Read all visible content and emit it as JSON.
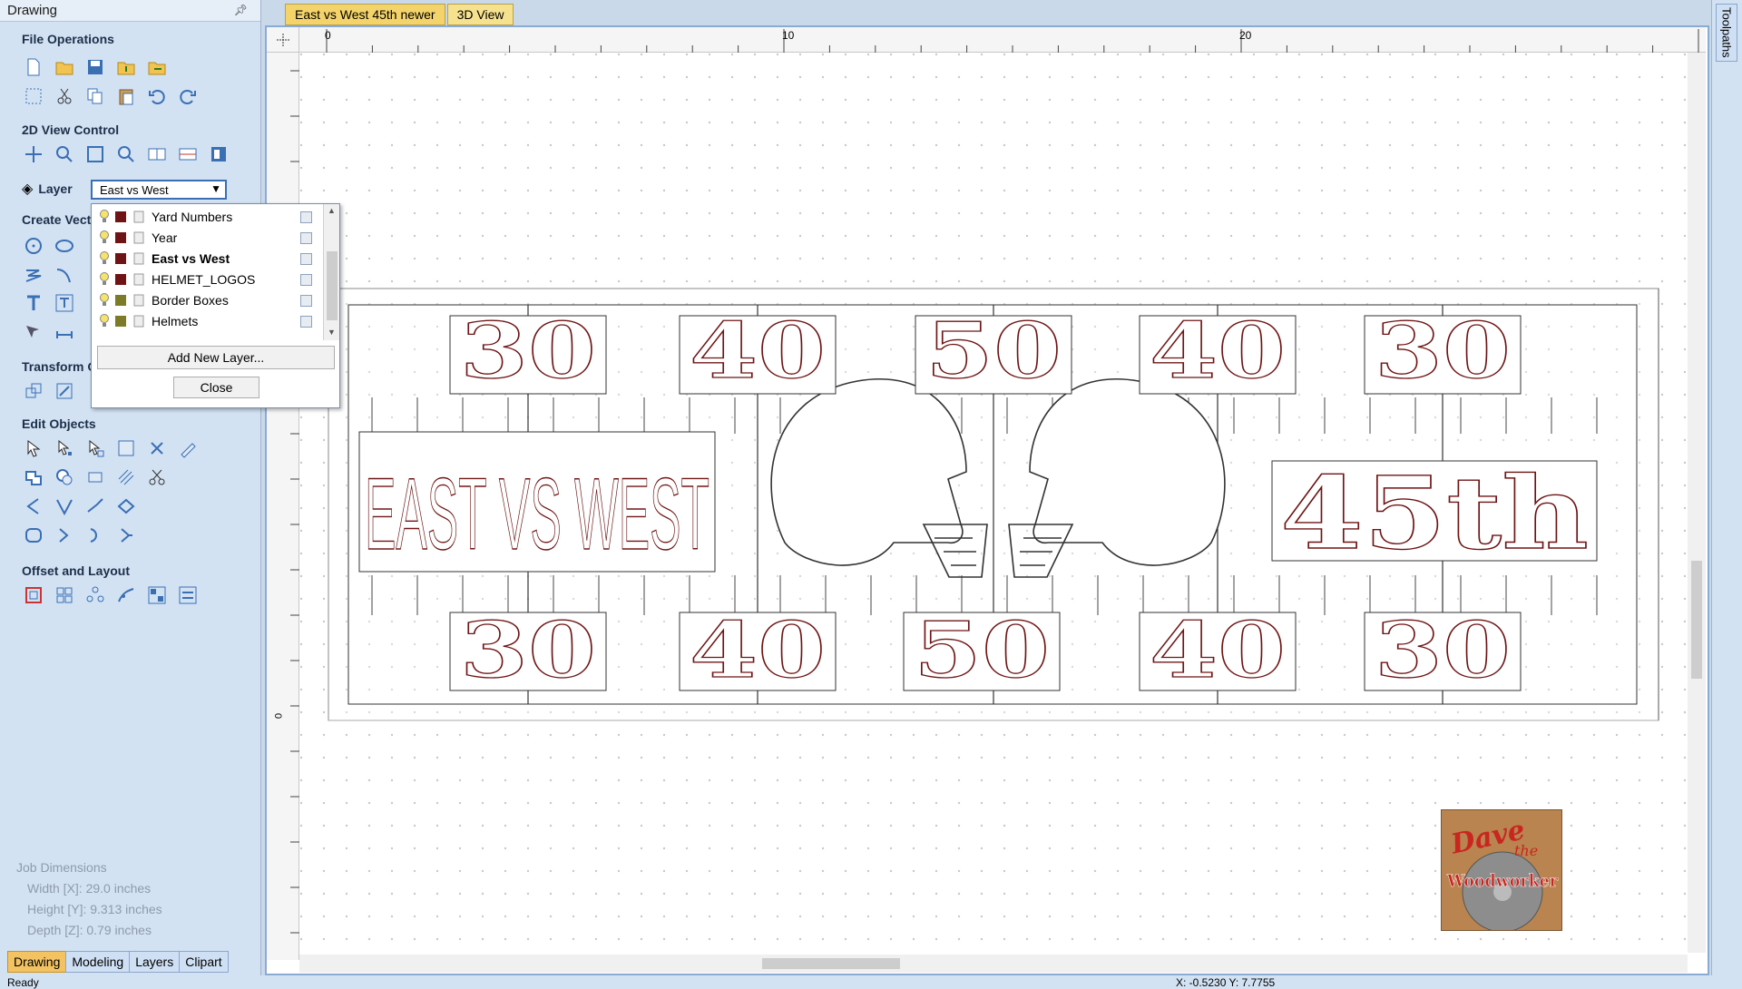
{
  "panel": {
    "title": "Drawing",
    "sections": {
      "file_operations": "File Operations",
      "view_control": "2D View Control",
      "create_vectors": "Create Vect",
      "transform": "Transform O",
      "edit_objects": "Edit Objects",
      "offset_layout": "Offset and Layout"
    },
    "layer": {
      "label": "Layer",
      "selected": "East vs West",
      "items": [
        {
          "name": "Yard Numbers",
          "color": "#6e1414",
          "bulb": "on"
        },
        {
          "name": "Year",
          "color": "#6e1414",
          "bulb": "on"
        },
        {
          "name": "East vs West",
          "color": "#6e1414",
          "bulb": "on",
          "active": true
        },
        {
          "name": "HELMET_LOGOS",
          "color": "#6e1414",
          "bulb": "on"
        },
        {
          "name": "Border Boxes",
          "color": "#7b7b2a",
          "bulb": "on"
        },
        {
          "name": "Helmets",
          "color": "#7b7b2a",
          "bulb": "on"
        }
      ],
      "add_button": "Add New Layer...",
      "close_button": "Close"
    },
    "job_dimensions": {
      "title": "Job Dimensions",
      "width": "Width  [X]: 29.0 inches",
      "height": "Height [Y]: 9.313 inches",
      "depth": "Depth  [Z]: 0.79 inches"
    },
    "bottom_tabs": [
      "Drawing",
      "Modeling",
      "Layers",
      "Clipart"
    ]
  },
  "doc_tabs": [
    "East vs West 45th newer",
    "3D View"
  ],
  "right_tab": "Toolpaths",
  "ruler": {
    "top_labels": [
      "0",
      "10",
      "20"
    ],
    "left_label": "0"
  },
  "design": {
    "yard_top": [
      "30",
      "40",
      "50",
      "40",
      "30"
    ],
    "yard_bottom": [
      "30",
      "40",
      "50",
      "40",
      "30"
    ],
    "banner": "EAST VS WEST",
    "year": "45th"
  },
  "logo": {
    "line1": "Dave",
    "line2": "the",
    "line3": "Woodworker"
  },
  "status": {
    "ready": "Ready",
    "coords": "X: -0.5230 Y: 7.7755"
  }
}
